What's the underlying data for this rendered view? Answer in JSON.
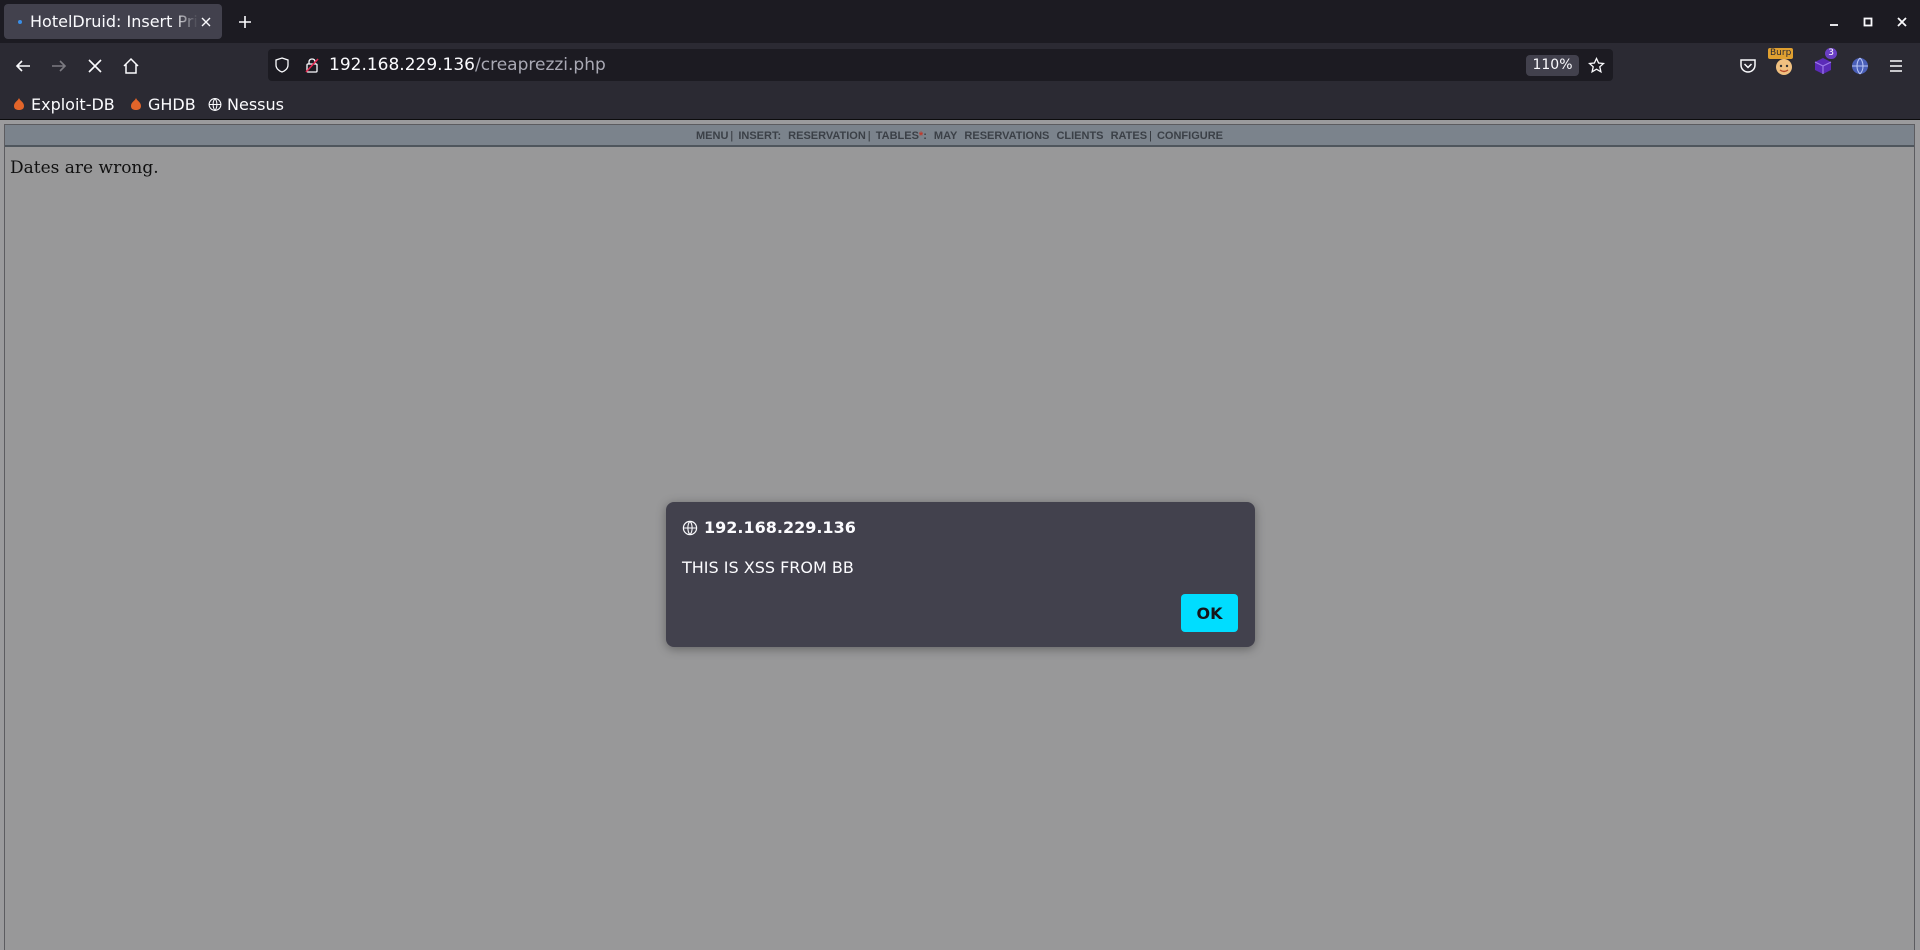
{
  "tab": {
    "title": "HotelDruid: Insert Prices"
  },
  "url": {
    "host": "192.168.229.136",
    "path": "/creaprezzi.php",
    "zoom": "110%"
  },
  "toolbar": {
    "burp_label": "Burp",
    "badge_count": "3"
  },
  "bookmarks": [
    {
      "label": "Exploit-DB",
      "icon": "flame-icon"
    },
    {
      "label": "GHDB",
      "icon": "flame-icon"
    },
    {
      "label": "Nessus",
      "icon": "globe-icon"
    }
  ],
  "hoteldruid_menu": {
    "menu": "MENU",
    "insert": "INSERT:",
    "reservation": "RESERVATION",
    "tables": "TABLES",
    "tables_star": "*",
    "may": "MAY",
    "reservations": "RESERVATIONS",
    "clients": "CLIENTS",
    "rates": "RATES",
    "configure": "CONFIGURE"
  },
  "page": {
    "message": "Dates are wrong."
  },
  "alert": {
    "origin": "192.168.229.136",
    "message": "THIS IS XSS FROM BB",
    "ok_label": "OK"
  },
  "colors": {
    "chrome_dark": "#1c1b22",
    "chrome": "#2b2a33",
    "accent": "#00ddff",
    "dialog": "#42414d"
  }
}
